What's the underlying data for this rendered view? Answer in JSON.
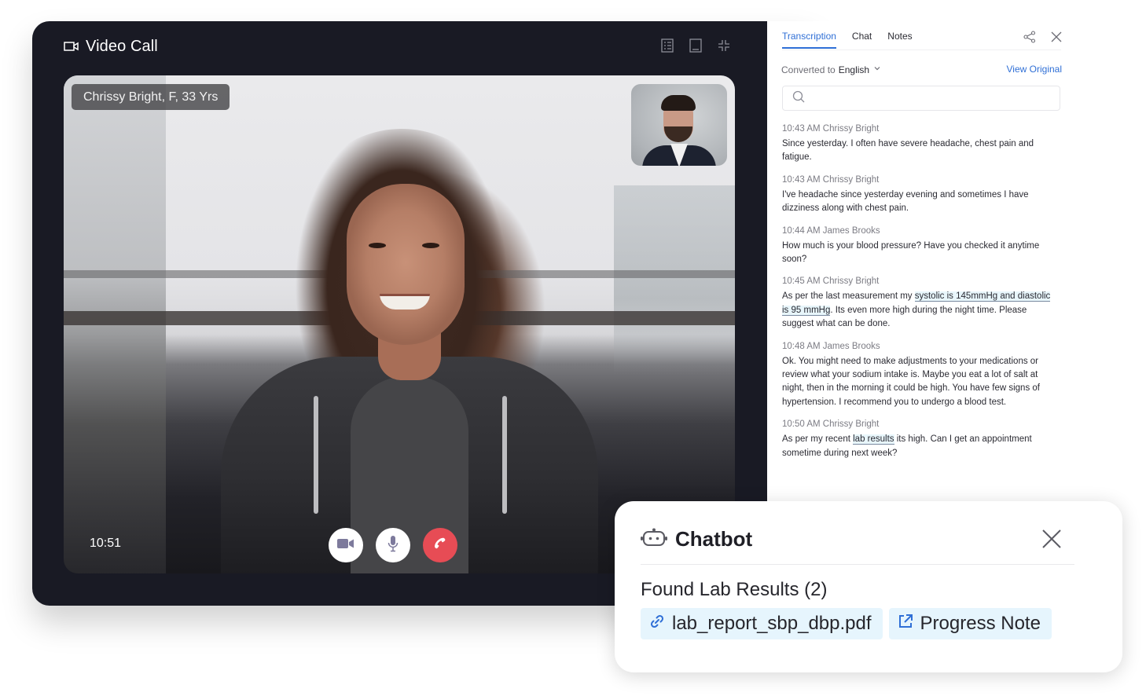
{
  "video_call": {
    "title": "Video Call",
    "caller_tag": "Chrissy Bright, F, 33 Yrs",
    "timer": "10:51",
    "header_tools": [
      "transcript-list-icon",
      "panel-icon",
      "minimize-icon"
    ],
    "controls": [
      "camera-icon",
      "microphone-icon",
      "end-call-icon"
    ],
    "end_call_color": "#e74c55"
  },
  "panel": {
    "tabs": [
      {
        "label": "Transcription",
        "active": true
      },
      {
        "label": "Chat",
        "active": false
      },
      {
        "label": "Notes",
        "active": false
      }
    ],
    "converted_label": "Converted to",
    "language": "English",
    "view_original": "View Original",
    "search": {
      "value": "",
      "placeholder": ""
    },
    "messages": [
      {
        "meta": "10:43 AM Chrissy Bright",
        "parts": [
          {
            "t": "Since yesterday. I often have severe headache, chest pain and fatigue."
          }
        ]
      },
      {
        "meta": "10:43 AM Chrissy Bright",
        "parts": [
          {
            "t": "I've headache since yesterday evening and sometimes I have dizziness along with chest pain."
          }
        ]
      },
      {
        "meta": "10:44 AM James Brooks",
        "parts": [
          {
            "t": "How much is your blood pressure? Have you checked it anytime soon?"
          }
        ]
      },
      {
        "meta": "10:45 AM Chrissy Bright",
        "parts": [
          {
            "t": "As per the last measurement my "
          },
          {
            "t": "systolic is 145mmHg and diastolic is 95 mmHg",
            "hl": true
          },
          {
            "t": ". Its even more high during the night time. Please suggest what can be done."
          }
        ]
      },
      {
        "meta": "10:48 AM James Brooks",
        "parts": [
          {
            "t": "Ok. You might need to make adjustments to your medications or review what your sodium intake is. Maybe you eat a lot of salt at night, then in the morning it could be high. You have few signs of hypertension. I recommend you to undergo a blood test."
          }
        ]
      },
      {
        "meta": "10:50 AM Chrissy Bright",
        "parts": [
          {
            "t": "As per my recent "
          },
          {
            "t": "lab results",
            "hl": true
          },
          {
            "t": " its high. Can I get an appointment sometime during next week?"
          }
        ]
      }
    ],
    "accent": "#2f6fd6"
  },
  "chatbot": {
    "title": "Chatbot",
    "found_label": "Found Lab Results (2)",
    "results": [
      {
        "label": "lab_report_sbp_dbp.pdf",
        "icon": "link-icon"
      },
      {
        "label": "Progress Note",
        "icon": "external-link-icon"
      }
    ],
    "chip_bg": "#e6f5fd"
  }
}
